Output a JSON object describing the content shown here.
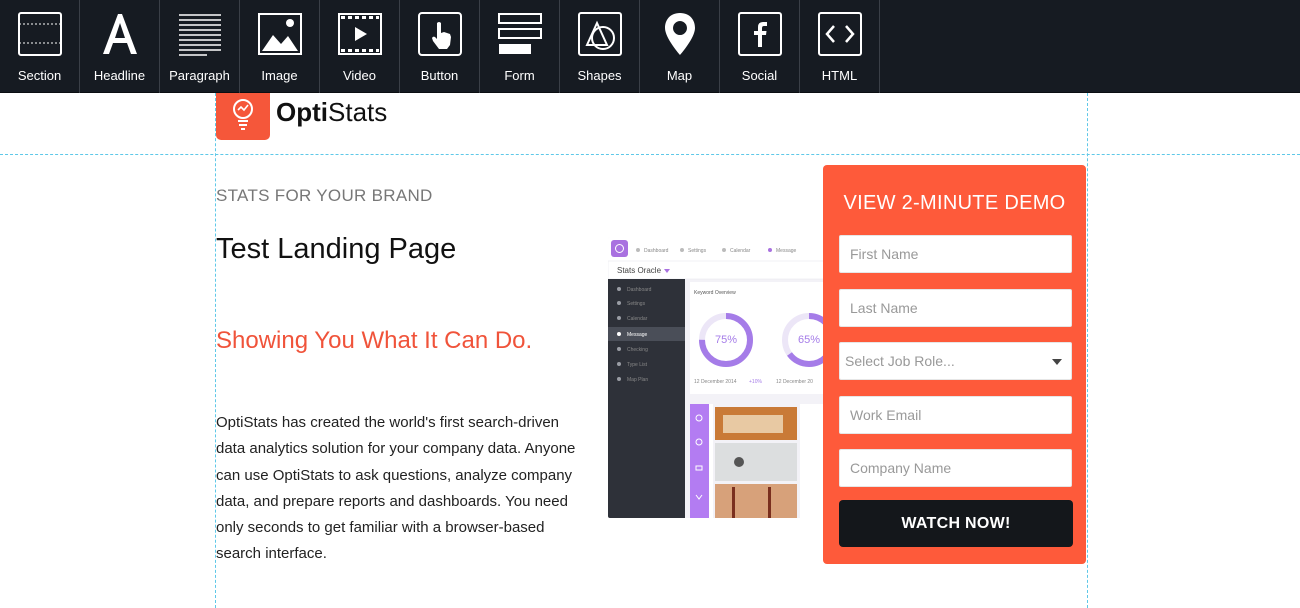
{
  "toolbar": {
    "items": [
      {
        "label": "Section",
        "icon": "section-icon"
      },
      {
        "label": "Headline",
        "icon": "headline-icon"
      },
      {
        "label": "Paragraph",
        "icon": "paragraph-icon"
      },
      {
        "label": "Image",
        "icon": "image-icon"
      },
      {
        "label": "Video",
        "icon": "video-icon"
      },
      {
        "label": "Button",
        "icon": "button-icon"
      },
      {
        "label": "Form",
        "icon": "form-icon"
      },
      {
        "label": "Shapes",
        "icon": "shapes-icon"
      },
      {
        "label": "Map",
        "icon": "map-pin-icon"
      },
      {
        "label": "Social",
        "icon": "facebook-icon"
      },
      {
        "label": "HTML",
        "icon": "code-icon"
      }
    ]
  },
  "logo": {
    "name_bold": "Opti",
    "name_rest": "Stats"
  },
  "hero": {
    "eyebrow": "STATS FOR YOUR BRAND",
    "headline": "Test Landing Page",
    "subheadline": "Showing You What It Can Do.",
    "paragraph": "OptiStats has created the world's first search-driven data analytics solution for your company data. Anyone can use OptiStats to ask questions, analyze company data, and prepare reports and dashboards. You need only seconds to get familiar with a browser-based search interface."
  },
  "screenshot": {
    "tabs": [
      "Dashboard",
      "Settings",
      "Calendar",
      "Message"
    ],
    "app_name": "Stats Oracle",
    "sidebar": [
      "Dashboard",
      "Settings",
      "Calendar",
      "Message",
      "Checking",
      "Type List",
      "Map Plan"
    ],
    "card_title": "Keyword Overview",
    "gauge1": {
      "label": "75%",
      "value": 0.75,
      "date": "12 December 2014",
      "delta": "+10%"
    },
    "gauge2": {
      "label": "65%",
      "value": 0.65,
      "date": "12 December 20"
    }
  },
  "form": {
    "title": "VIEW 2-MINUTE DEMO",
    "first_name": "First Name",
    "last_name": "Last Name",
    "job_role": "Select Job Role...",
    "email": "Work Email",
    "company": "Company Name",
    "button": "WATCH NOW!"
  },
  "colors": {
    "accent": "#fe5a3a",
    "toolbar": "#161b22",
    "guide": "#5fc8e8"
  }
}
